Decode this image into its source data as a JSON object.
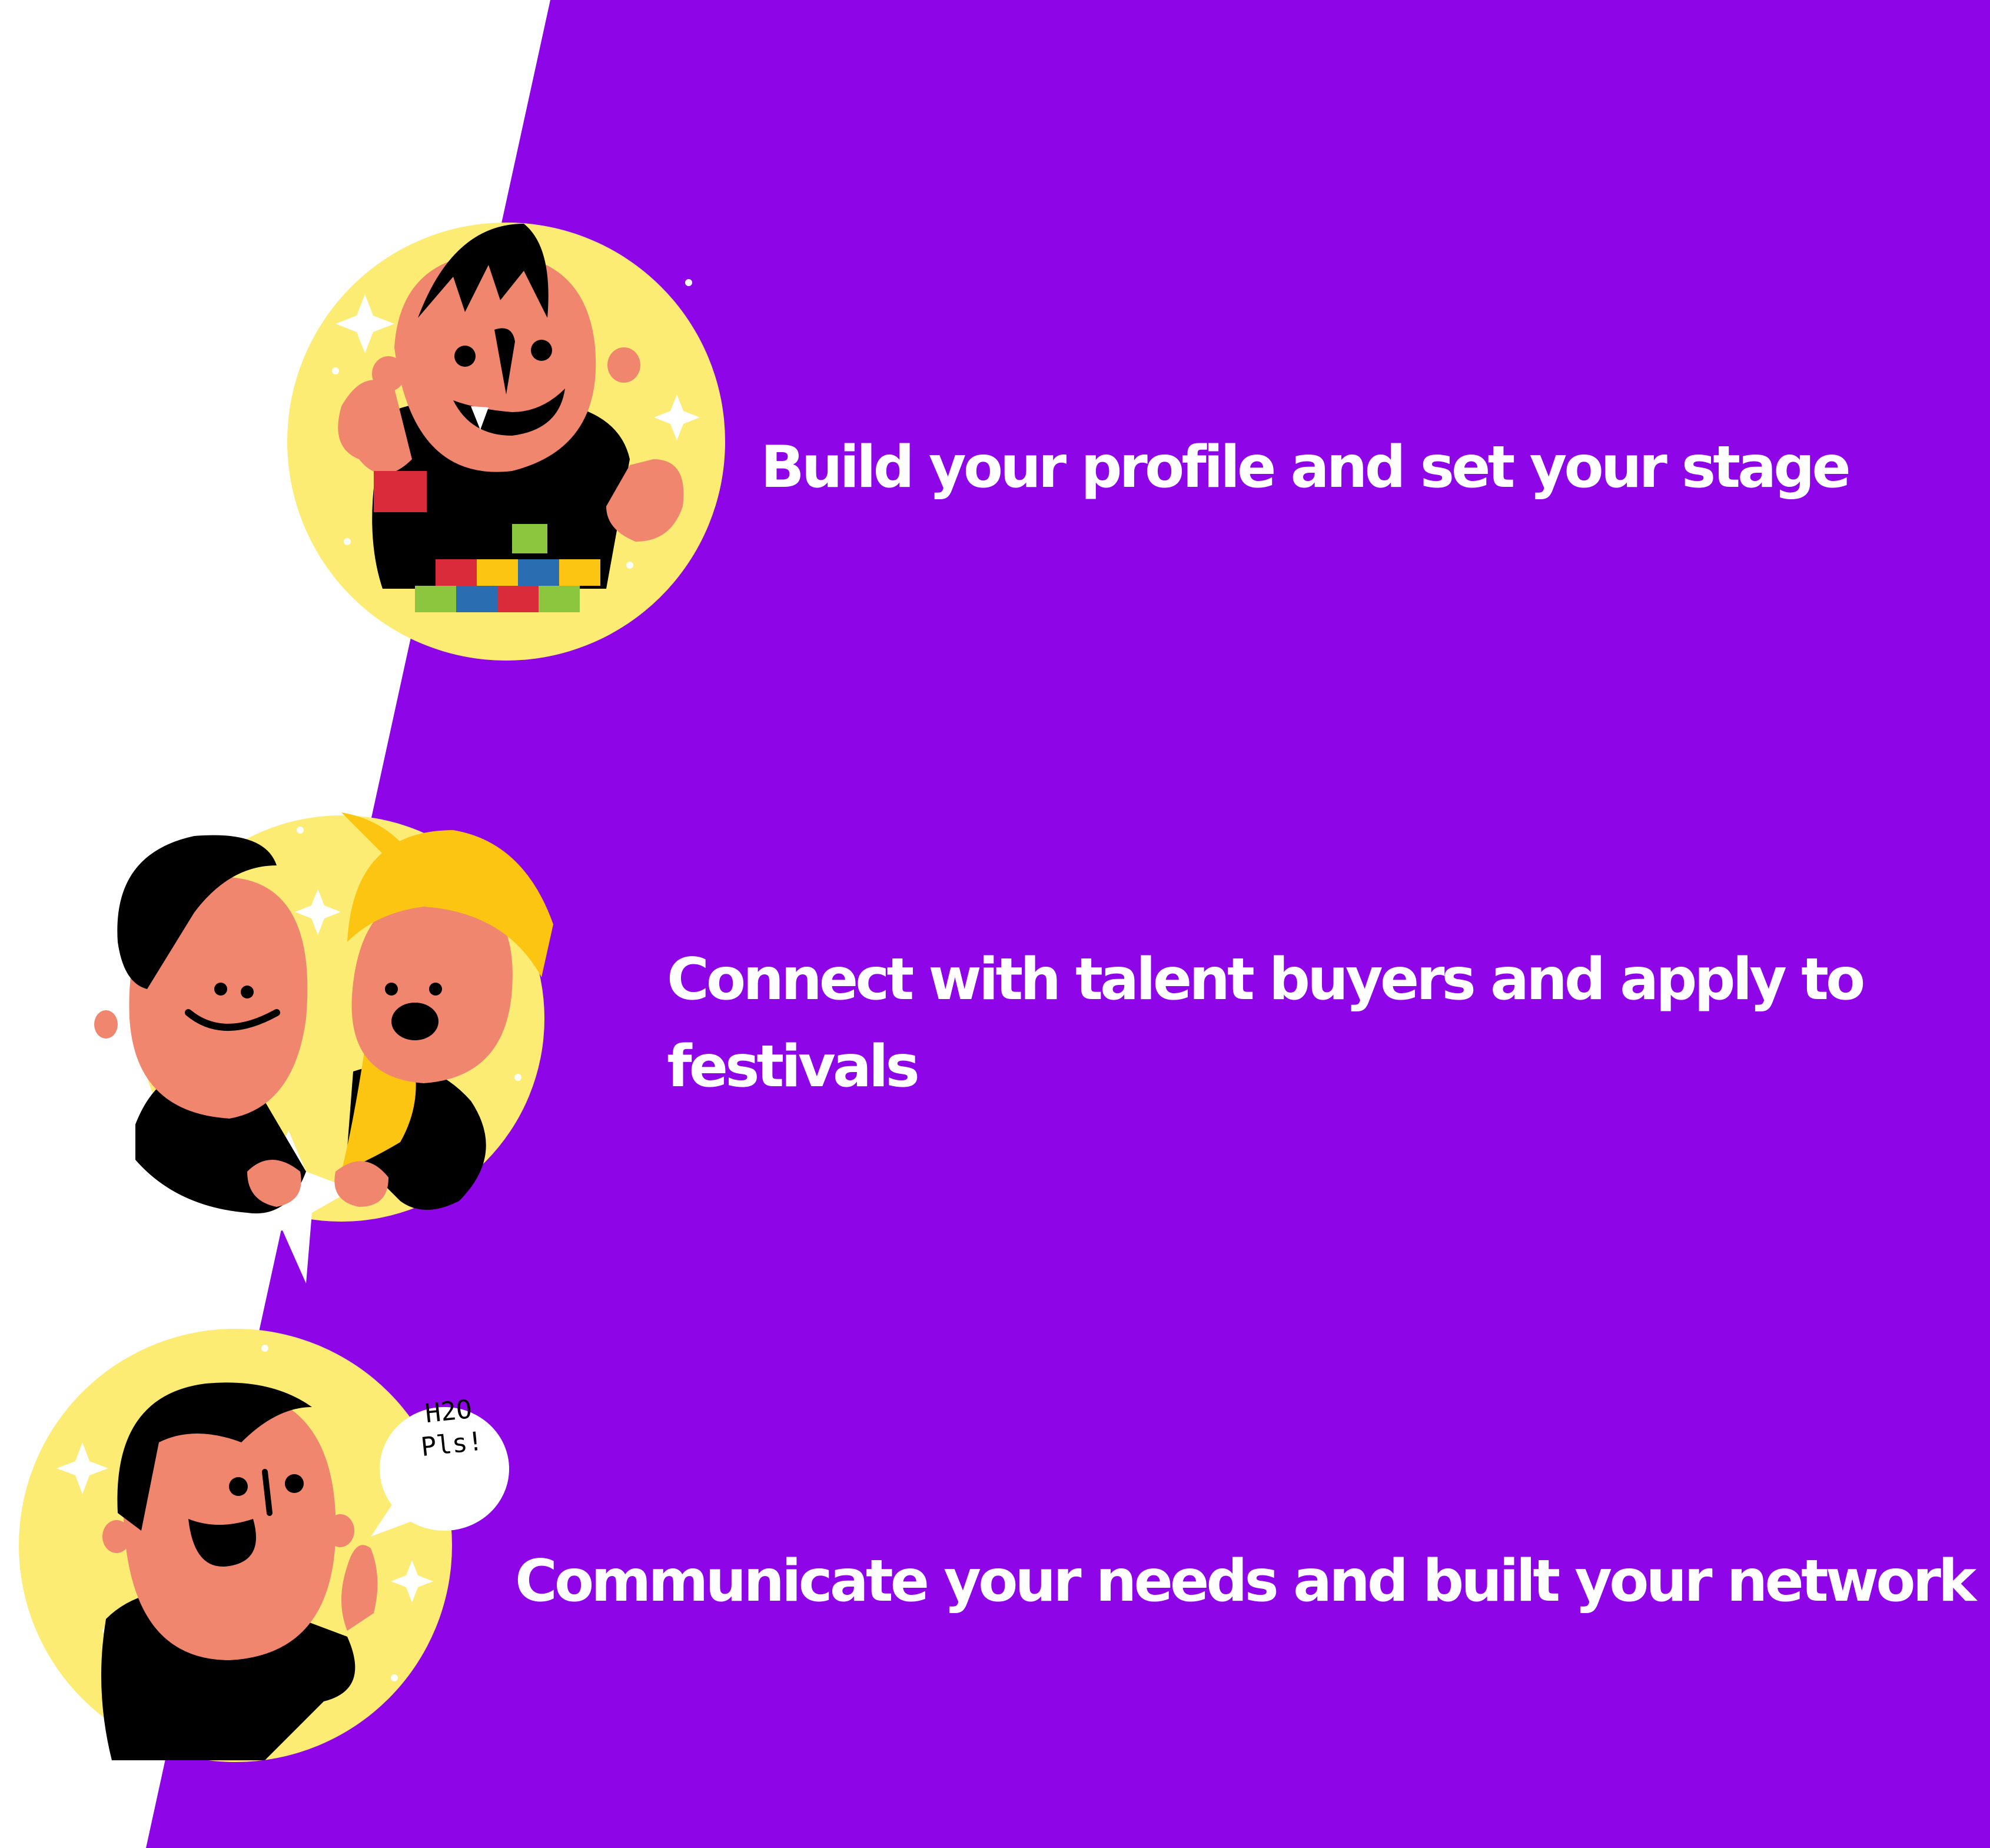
{
  "colors": {
    "background": "#ffffff",
    "panel": "#8e05e8",
    "circle": "#fcec74",
    "skin": "#f1866e",
    "hair": "#000000",
    "cap": "#fcc512",
    "text": "#ffffff"
  },
  "features": [
    {
      "text": "Build your profile and set your stage",
      "illustration": "person-building-blocks-icon"
    },
    {
      "text": "Connect with talent buyers and apply to festivals",
      "illustration": "two-people-high-five-icon"
    },
    {
      "text": "Communicate your needs and built your network",
      "illustration": "person-speech-bubble-icon",
      "bubble_text": [
        "H2O",
        "Pls!"
      ]
    }
  ]
}
